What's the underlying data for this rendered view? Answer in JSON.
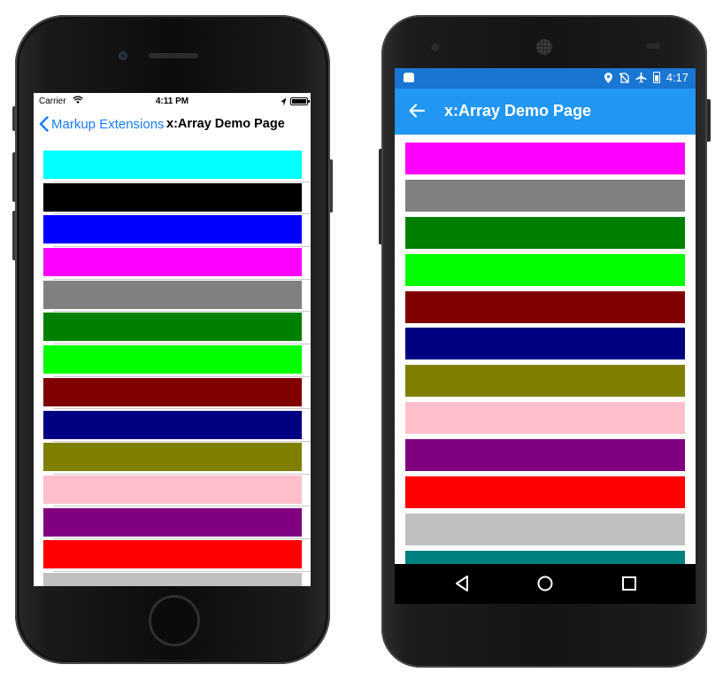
{
  "ios": {
    "status": {
      "carrier": "Carrier",
      "time": "4:11 PM"
    },
    "nav": {
      "back_label": "Markup Extensions",
      "title": "x:Array Demo Page"
    },
    "colors": [
      "#00ffff",
      "#000000",
      "#0000ff",
      "#ff00ff",
      "#808080",
      "#008000",
      "#00ff00",
      "#800000",
      "#000080",
      "#808000",
      "#ffc0cb",
      "#800080",
      "#ff0000",
      "#c0c0c0"
    ]
  },
  "android": {
    "status": {
      "time": "4:17"
    },
    "appbar": {
      "title": "x:Array Demo Page"
    },
    "colors": [
      "#ff00ff",
      "#808080",
      "#008000",
      "#00ff00",
      "#800000",
      "#000080",
      "#808000",
      "#ffc0cb",
      "#800080",
      "#ff0000",
      "#c0c0c0",
      "#008080"
    ],
    "navbar": [
      "back-icon",
      "home-icon",
      "recents-icon"
    ]
  }
}
